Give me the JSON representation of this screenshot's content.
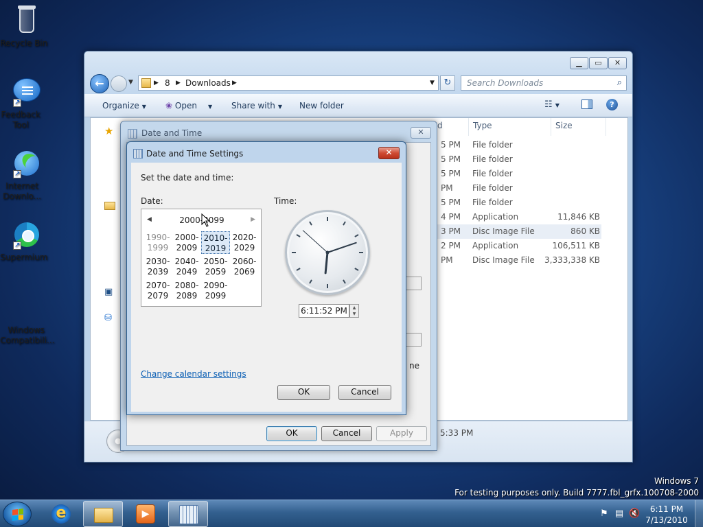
{
  "desktop": {
    "icons": [
      {
        "label": "Recycle Bin"
      },
      {
        "label": "Feedback Tool"
      },
      {
        "label": "Internet Downlo..."
      },
      {
        "label": "Supermium"
      },
      {
        "label": "Windows Compatibili..."
      }
    ],
    "watermark": {
      "line1": "Windows 7",
      "line2": "For testing purposes only. Build 7777.fbl_grfx.100708-2000"
    }
  },
  "taskbar": {
    "time": "6:11 PM",
    "date": "7/13/2010"
  },
  "explorer": {
    "address": {
      "seg1": "8",
      "seg2": "Downloads"
    },
    "search_placeholder": "Search Downloads",
    "toolbar": {
      "organize": "Organize",
      "open": "Open",
      "share_with": "Share with",
      "new_folder": "New folder"
    },
    "columns": {
      "date": "d",
      "type": "Type",
      "size": "Size"
    },
    "rows": [
      {
        "time": "5 PM",
        "type": "File folder",
        "size": ""
      },
      {
        "time": "5 PM",
        "type": "File folder",
        "size": ""
      },
      {
        "time": "5 PM",
        "type": "File folder",
        "size": ""
      },
      {
        "time": "PM",
        "type": "File folder",
        "size": ""
      },
      {
        "time": "5 PM",
        "type": "File folder",
        "size": ""
      },
      {
        "time": "4 PM",
        "type": "Application",
        "size": "11,846 KB"
      },
      {
        "time": "3 PM",
        "type": "Disc Image File",
        "size": "860 KB"
      },
      {
        "time": "2 PM",
        "type": "Application",
        "size": "106,511 KB"
      },
      {
        "time": "PM",
        "type": "Disc Image File",
        "size": "3,333,338 KB"
      }
    ],
    "status_time": "5:33 PM",
    "partial_text": "ne"
  },
  "date_time": {
    "title": "Date and Time",
    "ok": "OK",
    "cancel": "Cancel",
    "apply": "Apply"
  },
  "settings": {
    "title": "Date and Time Settings",
    "prompt": "Set the date and time:",
    "date_label": "Date:",
    "time_label": "Time:",
    "calendar": {
      "header": "2000-2099",
      "decades": [
        {
          "a": "1990-",
          "b": "1999",
          "state": "dim"
        },
        {
          "a": "2000-",
          "b": "2009",
          "state": ""
        },
        {
          "a": "2010-",
          "b": "2019",
          "state": "sel"
        },
        {
          "a": "2020-",
          "b": "2029",
          "state": ""
        },
        {
          "a": "2030-",
          "b": "2039",
          "state": ""
        },
        {
          "a": "2040-",
          "b": "2049",
          "state": ""
        },
        {
          "a": "2050-",
          "b": "2059",
          "state": ""
        },
        {
          "a": "2060-",
          "b": "2069",
          "state": ""
        },
        {
          "a": "2070-",
          "b": "2079",
          "state": ""
        },
        {
          "a": "2080-",
          "b": "2089",
          "state": ""
        },
        {
          "a": "2090-",
          "b": "2099",
          "state": ""
        }
      ]
    },
    "clock": {
      "hour": 6,
      "minute": 11,
      "second": 52
    },
    "time_value": "6:11:52 PM",
    "change_calendar_link": "Change calendar settings",
    "ok": "OK",
    "cancel": "Cancel"
  },
  "colors": {
    "desktop": "#1a4789",
    "selection": "#dce9f7",
    "link": "#0b5fb4",
    "close_red": "#cf4b34"
  }
}
